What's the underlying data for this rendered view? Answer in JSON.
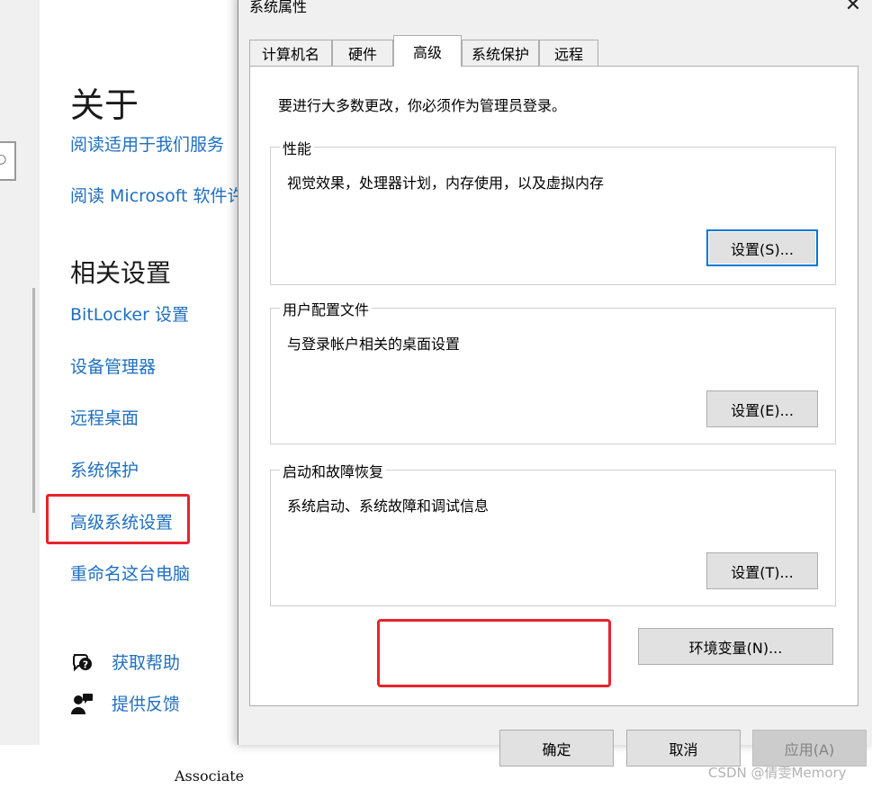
{
  "background": {
    "about_title": "关于",
    "links_top": [
      "阅读适用于我们服务",
      "阅读 Microsoft 软件许"
    ],
    "related_title": "相关设置",
    "related_links": [
      "BitLocker 设置",
      "设备管理器",
      "远程桌面",
      "系统保护",
      "高级系统设置",
      "重命名这台电脑"
    ],
    "help": "获取帮助",
    "feedback": "提供反馈",
    "associate_text": "Associate",
    "search_glyph": "○"
  },
  "dialog": {
    "title": "系统属性",
    "close_glyph": "✕",
    "tabs": [
      {
        "label": "计算机名",
        "active": false
      },
      {
        "label": "硬件",
        "active": false
      },
      {
        "label": "高级",
        "active": true
      },
      {
        "label": "系统保护",
        "active": false
      },
      {
        "label": "远程",
        "active": false
      }
    ],
    "admin_note": "要进行大多数更改，你必须作为管理员登录。",
    "groups": [
      {
        "label": "性能",
        "desc": "视觉效果，处理器计划，内存使用，以及虚拟内存",
        "button": "设置(S)..."
      },
      {
        "label": "用户配置文件",
        "desc": "与登录帐户相关的桌面设置",
        "button": "设置(E)..."
      },
      {
        "label": "启动和故障恢复",
        "desc": "系统启动、系统故障和调试信息",
        "button": "设置(T)..."
      }
    ],
    "env_button": "环境变量(N)...",
    "ok": "确定",
    "cancel": "取消",
    "apply": "应用(A)"
  },
  "watermark": "CSDN @倩雯Memory",
  "colors": {
    "accent": "#0078d7",
    "link": "#1f6fc0",
    "highlight": "#e8242b"
  }
}
